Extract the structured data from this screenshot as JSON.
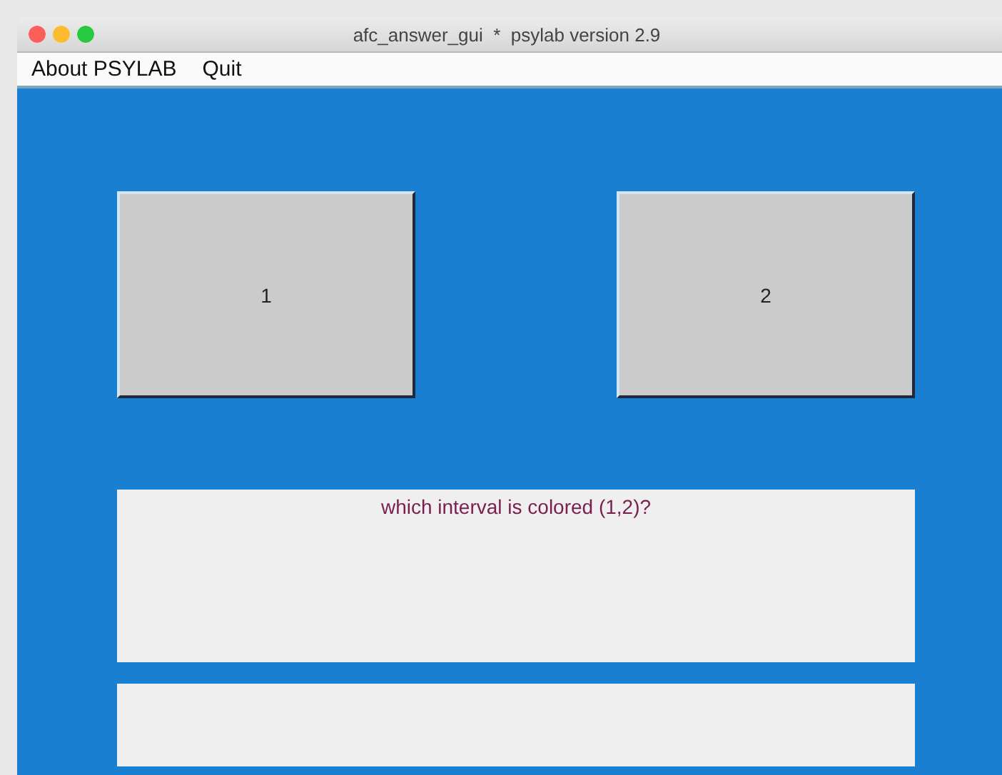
{
  "window": {
    "title": "afc_answer_gui  *  psylab version 2.9"
  },
  "menu": [
    "About PSYLAB",
    "Quit"
  ],
  "answer_buttons": [
    {
      "label": "1"
    },
    {
      "label": "2"
    }
  ],
  "prompt": {
    "text": "which interval is colored (1,2)?"
  }
}
